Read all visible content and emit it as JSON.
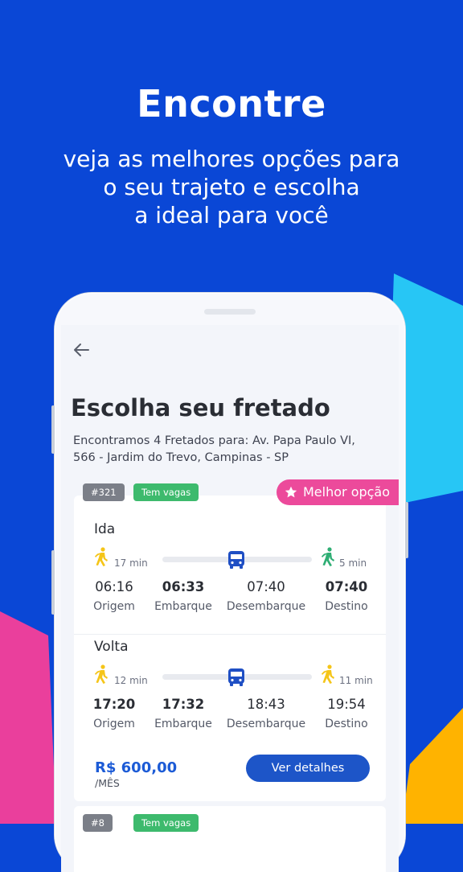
{
  "hero": {
    "title": "Encontre",
    "subtitle_lines": [
      "veja as melhores opções para",
      "o seu trajeto e escolha",
      "a ideal para você"
    ]
  },
  "screen": {
    "back_icon": "arrow-left-icon",
    "title": "Escolha seu fretado",
    "description": "Encontramos 4 Fretados para: Av. Papa Paulo VI, 566 - Jardim do Trevo, Campinas - SP",
    "options": [
      {
        "number": "#321",
        "availability": "Tem vagas",
        "best_badge": "Melhor opção",
        "ida": {
          "title": "Ida",
          "walk_start": "17 min",
          "walk_end": "5 min",
          "times": [
            "06:16",
            "06:33",
            "07:40",
            "07:40"
          ],
          "labels": [
            "Origem",
            "Embarque",
            "Desembarque",
            "Destino"
          ]
        },
        "volta": {
          "title": "Volta",
          "walk_start": "12 min",
          "walk_end": "11 min",
          "times": [
            "17:20",
            "17:32",
            "18:43",
            "19:54"
          ],
          "labels": [
            "Origem",
            "Embarque",
            "Desembarque",
            "Destino"
          ]
        },
        "price": "R$ 600,00",
        "period": "/MÊS",
        "details_button": "Ver detalhes"
      },
      {
        "number": "#8",
        "availability": "Tem vagas"
      }
    ]
  },
  "colors": {
    "background": "#0a47d6",
    "accent_pink": "#ec4a9b",
    "accent_green": "#3dba6d",
    "button_blue": "#1d55c8",
    "walk_yellow": "#f5c518",
    "walk_green": "#2fae74",
    "bus_blue": "#1f4fc4"
  }
}
